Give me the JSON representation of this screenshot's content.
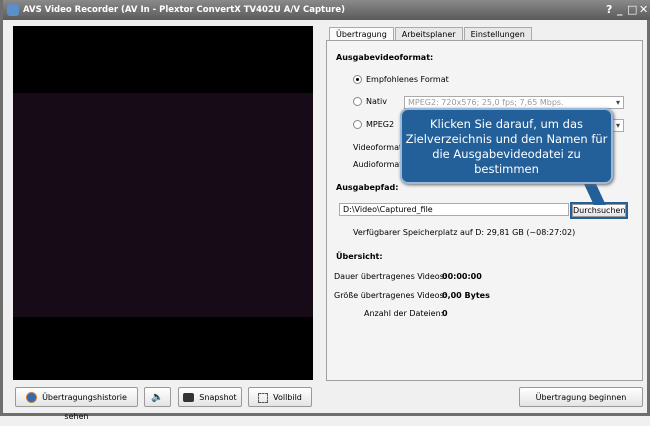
{
  "window": {
    "title": "AVS Video Recorder (AV In - Plextor ConvertX TV402U A/V Capture)",
    "help": "?",
    "minimize": "_",
    "maximize": "□",
    "close": "✕"
  },
  "tabs": [
    {
      "label": "Übertragung"
    },
    {
      "label": "Arbeitsplaner"
    },
    {
      "label": "Einstellungen"
    }
  ],
  "format": {
    "heading": "Ausgabevideoformat:",
    "recommended": "Empfohlenes Format",
    "native": "Nativ",
    "native_value": "MPEG2: 720x576; 25,0 fps; 7,65 Mbps.",
    "mpeg2": "MPEG2",
    "videoformat": "Videoformat:",
    "audioformat": "Audioformat:"
  },
  "path": {
    "heading": "Ausgabepfad:",
    "value": "D:\\Video\\Captured_file",
    "browse": "Durchsuchen",
    "free_space": "Verfügbarer Speicherplatz auf D: 29,81 GB (~08:27:02)"
  },
  "overview": {
    "heading": "Übersicht:",
    "duration_label": "Dauer übertragenes Videos:",
    "duration": "00:00:00",
    "size_label": "Größe übertragenes Videos:",
    "size": "0,00 Bytes",
    "count_label": "Anzahl der Dateien:",
    "count": "0"
  },
  "callout": "Klicken Sie darauf, um das Zielverzeichnis und den Namen für die Ausgabevideodatei zu bestimmen",
  "bottom": {
    "history": "Übertragungshistorie sehen",
    "snapshot": "Snapshot",
    "fullscreen": "Vollbild",
    "start": "Übertragung beginnen"
  }
}
